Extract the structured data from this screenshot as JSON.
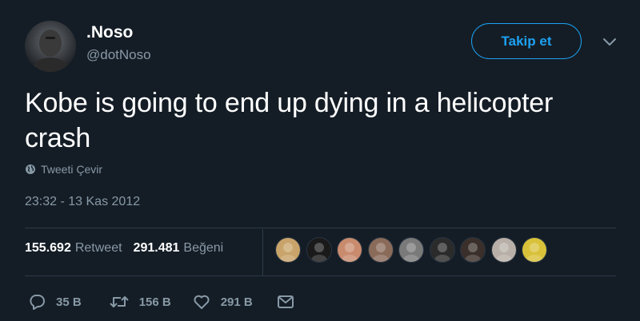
{
  "user": {
    "display_name": ".Noso",
    "handle": "@dotNoso",
    "avatar_icon": "user-avatar"
  },
  "follow_button": {
    "label": "Takip et"
  },
  "menu": {
    "icon": "chevron-down-icon"
  },
  "tweet": {
    "text": "Kobe is going to end up dying in a helicopter crash",
    "translate_label": "Tweeti Çevir",
    "timestamp": "23:32 - 13 Kas 2012"
  },
  "stats": {
    "retweets_count": "155.692",
    "retweets_label": "Retweet",
    "likes_count": "291.481",
    "likes_label": "Beğeni"
  },
  "likers": [
    {
      "name": "liker-1",
      "color": "#c9a46a"
    },
    {
      "name": "liker-2",
      "color": "#1a1a1a"
    },
    {
      "name": "liker-3",
      "color": "#c98b6e"
    },
    {
      "name": "liker-4",
      "color": "#8a6b5a"
    },
    {
      "name": "liker-5",
      "color": "#7a7a7a"
    },
    {
      "name": "liker-6",
      "color": "#2b2b2b"
    },
    {
      "name": "liker-7",
      "color": "#3a2f2a"
    },
    {
      "name": "liker-8",
      "color": "#b8b0a8"
    },
    {
      "name": "liker-9",
      "color": "#d9c23a"
    }
  ],
  "actions": {
    "reply_count": "35 B",
    "retweet_count": "156 B",
    "like_count": "291 B"
  },
  "colors": {
    "background": "#141d26",
    "accent": "#1da1f2",
    "secondary_text": "#8899a6",
    "divider": "#2d3a47"
  }
}
